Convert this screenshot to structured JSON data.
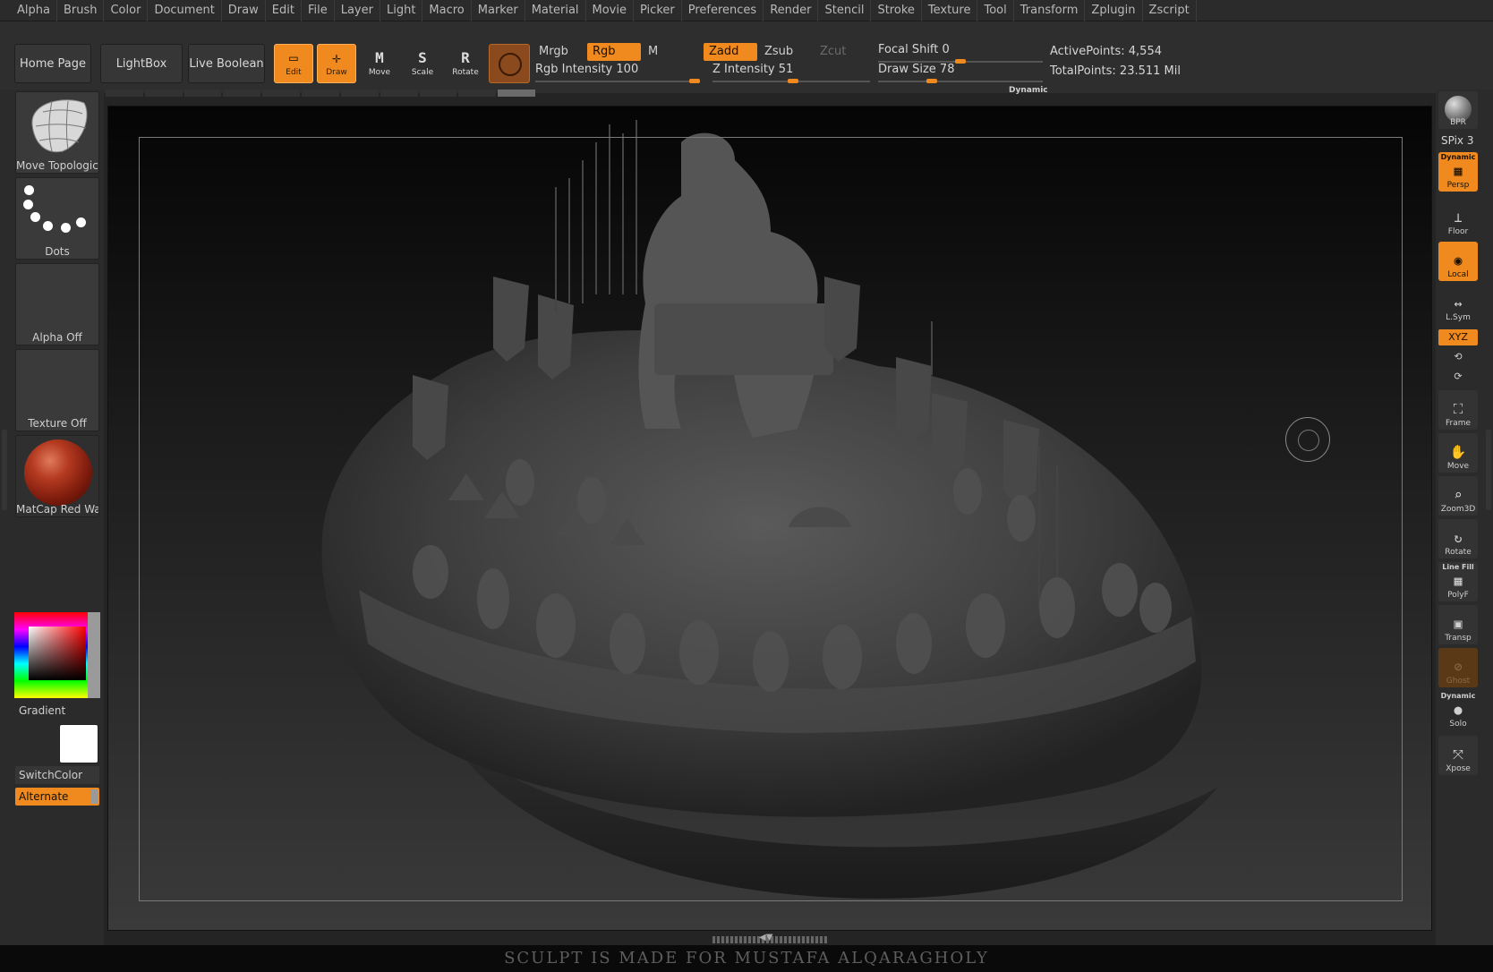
{
  "menu": [
    "Alpha",
    "Brush",
    "Color",
    "Document",
    "Draw",
    "Edit",
    "File",
    "Layer",
    "Light",
    "Macro",
    "Marker",
    "Material",
    "Movie",
    "Picker",
    "Preferences",
    "Render",
    "Stencil",
    "Stroke",
    "Texture",
    "Tool",
    "Transform",
    "Zplugin",
    "Zscript"
  ],
  "shelf": {
    "home_page": "Home Page",
    "lightbox": "LightBox",
    "live_boolean": "Live Boolean",
    "tools": [
      {
        "label": "Edit",
        "glyph": "▭",
        "active": true
      },
      {
        "label": "Draw",
        "glyph": "✛",
        "active": true
      },
      {
        "label": "Move",
        "glyph": "M",
        "active": false
      },
      {
        "label": "Scale",
        "glyph": "S",
        "active": false
      },
      {
        "label": "Rotate",
        "glyph": "R",
        "active": false
      }
    ],
    "mrgb": "Mrgb",
    "rgb": "Rgb",
    "m": "M",
    "zadd": "Zadd",
    "zsub": "Zsub",
    "zcut": "Zcut",
    "rgb_intensity_label": "Rgb Intensity",
    "rgb_intensity": "100",
    "rgb_intensity_value": 100,
    "z_intensity_label": "Z Intensity",
    "z_intensity": "51",
    "z_intensity_value": 51,
    "focal_shift_label": "Focal Shift",
    "focal_shift": "0",
    "focal_shift_value": 0,
    "draw_size_label": "Draw Size",
    "draw_size": "78",
    "draw_size_value": 78,
    "dynamic": "Dynamic",
    "active_points": "ActivePoints: 4,554",
    "total_points": "TotalPoints: 23.511 Mil"
  },
  "left": {
    "brush_label": "Move Topological",
    "stroke_label": "Dots",
    "alpha_label": "Alpha Off",
    "texture_label": "Texture Off",
    "material_label": "MatCap Red Wax",
    "gradient": "Gradient",
    "switch_color": "SwitchColor",
    "alternate": "Alternate"
  },
  "right": {
    "bpr": "BPR",
    "spix": "SPix 3",
    "persp_tag": "Dynamic",
    "persp": "Persp",
    "floor": "Floor",
    "local": "Local",
    "lsym": "L.Sym",
    "xyz": "XYZ",
    "frame": "Frame",
    "move": "Move",
    "zoom3d": "Zoom3D",
    "rotate": "Rotate",
    "polyf_tag": "Line Fill",
    "polyf": "PolyF",
    "transp": "Transp",
    "ghost": "Ghost",
    "solo_tag": "Dynamic",
    "solo": "Solo",
    "xpose": "Xpose"
  },
  "footer": "SCULPT  IS MADE FOR MUSTAFA ALQARAGHOLY",
  "colors": {
    "accent": "#f08a1f",
    "panel": "#2b2b2b",
    "viewport_top": "#050505",
    "viewport_bottom": "#3a3a3a"
  }
}
